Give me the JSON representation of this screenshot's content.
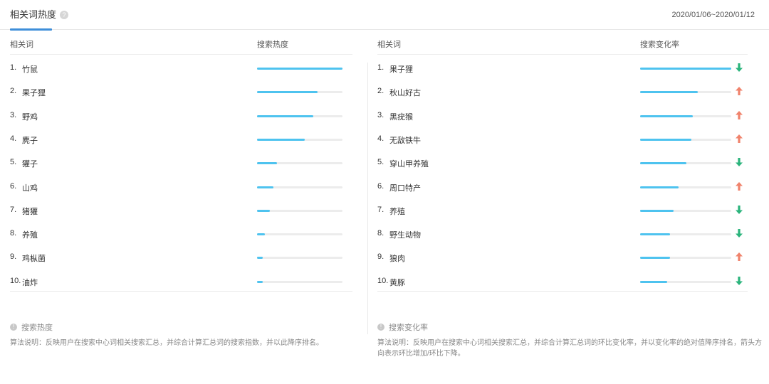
{
  "header": {
    "tab_label": "相关词热度",
    "help_symbol": "?",
    "date_range": "2020/01/06~2020/01/12"
  },
  "left": {
    "col_keyword": "相关词",
    "col_metric": "搜索热度",
    "rows": [
      {
        "idx": "1.",
        "keyword": "竹鼠",
        "fill": 1.0
      },
      {
        "idx": "2.",
        "keyword": "果子狸",
        "fill": 0.71
      },
      {
        "idx": "3.",
        "keyword": "野鸡",
        "fill": 0.66
      },
      {
        "idx": "4.",
        "keyword": "麂子",
        "fill": 0.56
      },
      {
        "idx": "5.",
        "keyword": "獾子",
        "fill": 0.23
      },
      {
        "idx": "6.",
        "keyword": "山鸡",
        "fill": 0.19
      },
      {
        "idx": "7.",
        "keyword": "猪獾",
        "fill": 0.15
      },
      {
        "idx": "8.",
        "keyword": "养殖",
        "fill": 0.09
      },
      {
        "idx": "9.",
        "keyword": "鸡枞菌",
        "fill": 0.07
      },
      {
        "idx": "10.",
        "keyword": "油炸",
        "fill": 0.07
      }
    ],
    "note_icon": "!",
    "note_title": "搜索热度",
    "note_desc": "算法说明：反映用户在搜索中心词相关搜索汇总，并综合计算汇总词的搜索指数，并以此降序排名。"
  },
  "right": {
    "col_keyword": "相关词",
    "col_metric": "搜索变化率",
    "rows": [
      {
        "idx": "1.",
        "keyword": "果子狸",
        "fill": 1.0,
        "dir": "down"
      },
      {
        "idx": "2.",
        "keyword": "秋山好古",
        "fill": 0.63,
        "dir": "up"
      },
      {
        "idx": "3.",
        "keyword": "黑疣猴",
        "fill": 0.58,
        "dir": "up"
      },
      {
        "idx": "4.",
        "keyword": "无敌铁牛",
        "fill": 0.56,
        "dir": "up"
      },
      {
        "idx": "5.",
        "keyword": "穿山甲养殖",
        "fill": 0.51,
        "dir": "down"
      },
      {
        "idx": "6.",
        "keyword": "周口特产",
        "fill": 0.42,
        "dir": "up"
      },
      {
        "idx": "7.",
        "keyword": "养殖",
        "fill": 0.37,
        "dir": "down"
      },
      {
        "idx": "8.",
        "keyword": "野生动物",
        "fill": 0.33,
        "dir": "down"
      },
      {
        "idx": "9.",
        "keyword": "狼肉",
        "fill": 0.33,
        "dir": "up"
      },
      {
        "idx": "10.",
        "keyword": "黄豚",
        "fill": 0.3,
        "dir": "down"
      }
    ],
    "note_icon": "!",
    "note_title": "搜索变化率",
    "note_desc": "算法说明：反映用户在搜索中心词相关搜索汇总，并综合计算汇总词的环比变化率，并以变化率的绝对值降序排名，箭头方向表示环比增加/环比下降。"
  },
  "colors": {
    "bar_fill": "#4ec3ef",
    "bar_track": "#ececec",
    "arrow_up": "#f0836c",
    "arrow_down": "#2bb47c",
    "tab_accent": "#3e8ed9"
  },
  "icons": {
    "help": "question-circle-icon",
    "info": "info-circle-icon",
    "up": "arrow-up-icon",
    "down": "arrow-down-icon"
  }
}
